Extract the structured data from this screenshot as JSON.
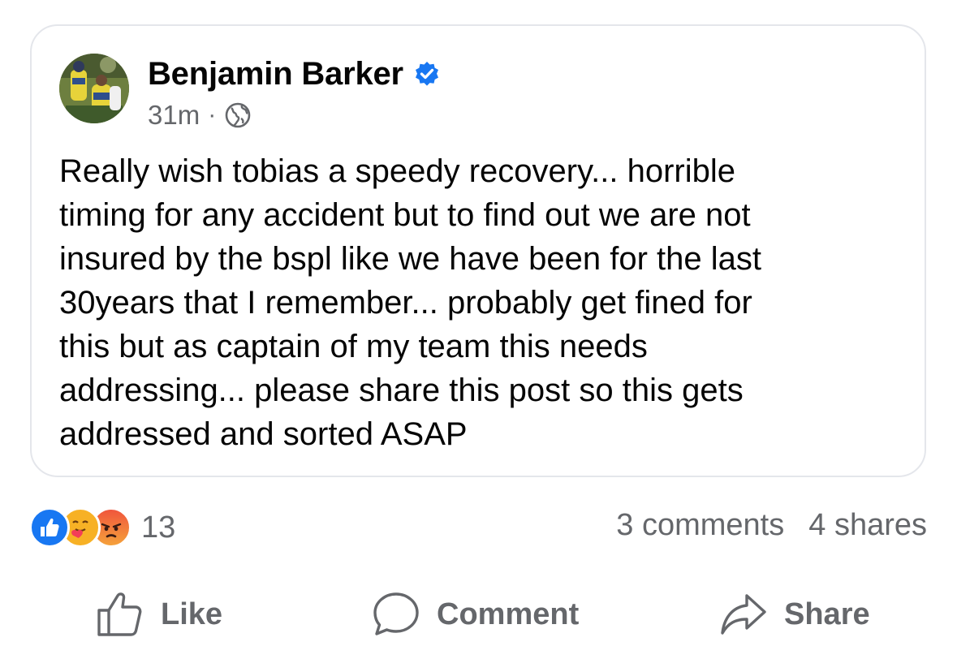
{
  "post": {
    "author_name": "Benjamin Barker",
    "verified_icon": "verified-badge-icon",
    "timestamp": "31m",
    "separator": "·",
    "audience_icon": "globe-icon",
    "text": "Really wish tobias a speedy recovery... horrible\ntiming for any accident but to find out we are not\ninsured by the bspl like we have been for the last\n30years that I remember... probably get fined for\nthis but as captain of my team this needs\naddressing... please share this post so this gets\naddressed and sorted ASAP"
  },
  "stats": {
    "reaction_icons": [
      "like-reaction-icon",
      "care-reaction-icon",
      "angry-reaction-icon"
    ],
    "reaction_count": "13",
    "comments": "3 comments",
    "shares": "4 shares"
  },
  "actions": {
    "like_label": "Like",
    "comment_label": "Comment",
    "share_label": "Share"
  },
  "colors": {
    "accent": "#1877f2",
    "secondary_text": "#65676b",
    "card_border": "#e4e6eb"
  }
}
